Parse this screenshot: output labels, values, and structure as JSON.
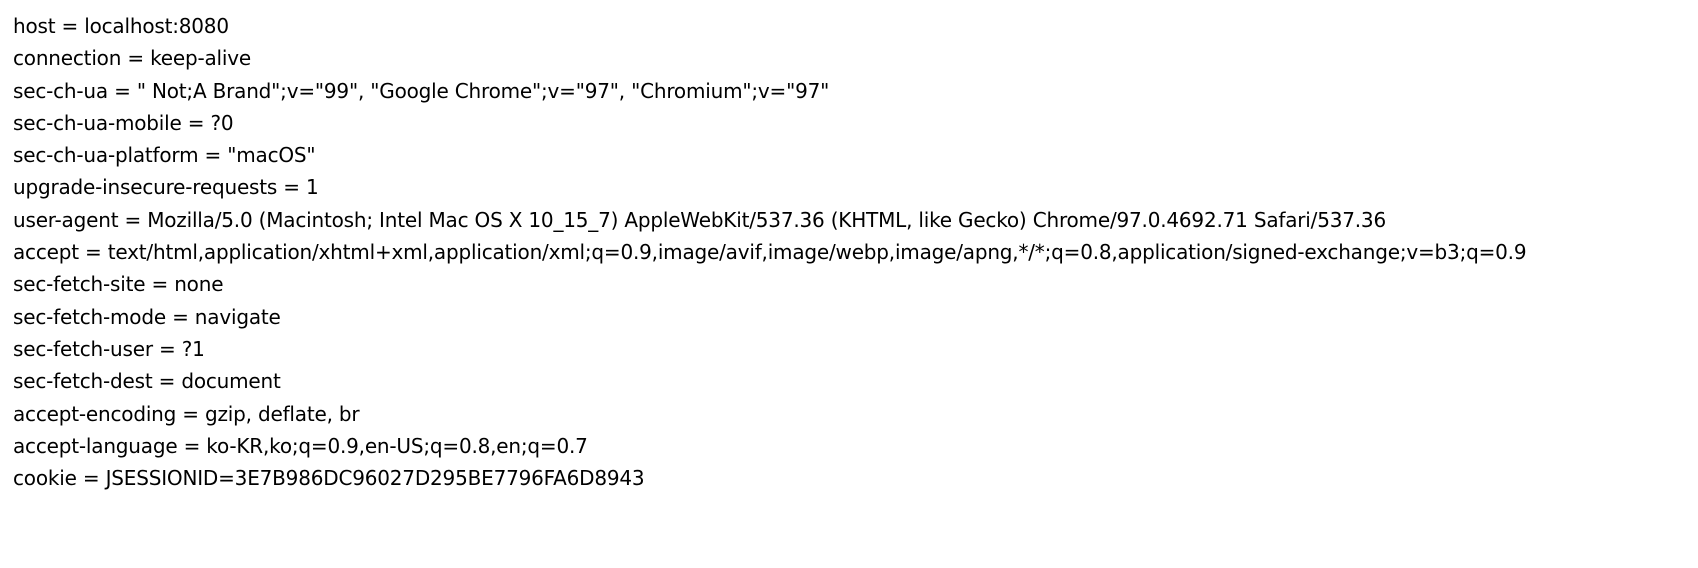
{
  "headers": [
    "host = localhost:8080",
    "connection = keep-alive",
    "sec-ch-ua = \" Not;A Brand\";v=\"99\", \"Google Chrome\";v=\"97\", \"Chromium\";v=\"97\"",
    "sec-ch-ua-mobile = ?0",
    "sec-ch-ua-platform = \"macOS\"",
    "upgrade-insecure-requests = 1",
    "user-agent = Mozilla/5.0 (Macintosh; Intel Mac OS X 10_15_7) AppleWebKit/537.36 (KHTML, like Gecko) Chrome/97.0.4692.71 Safari/537.36",
    "accept = text/html,application/xhtml+xml,application/xml;q=0.9,image/avif,image/webp,image/apng,*/*;q=0.8,application/signed-exchange;v=b3;q=0.9",
    "sec-fetch-site = none",
    "sec-fetch-mode = navigate",
    "sec-fetch-user = ?1",
    "sec-fetch-dest = document",
    "accept-encoding = gzip, deflate, br",
    "accept-language = ko-KR,ko;q=0.9,en-US;q=0.8,en;q=0.7",
    "cookie = JSESSIONID=3E7B986DC96027D295BE7796FA6D8943"
  ]
}
